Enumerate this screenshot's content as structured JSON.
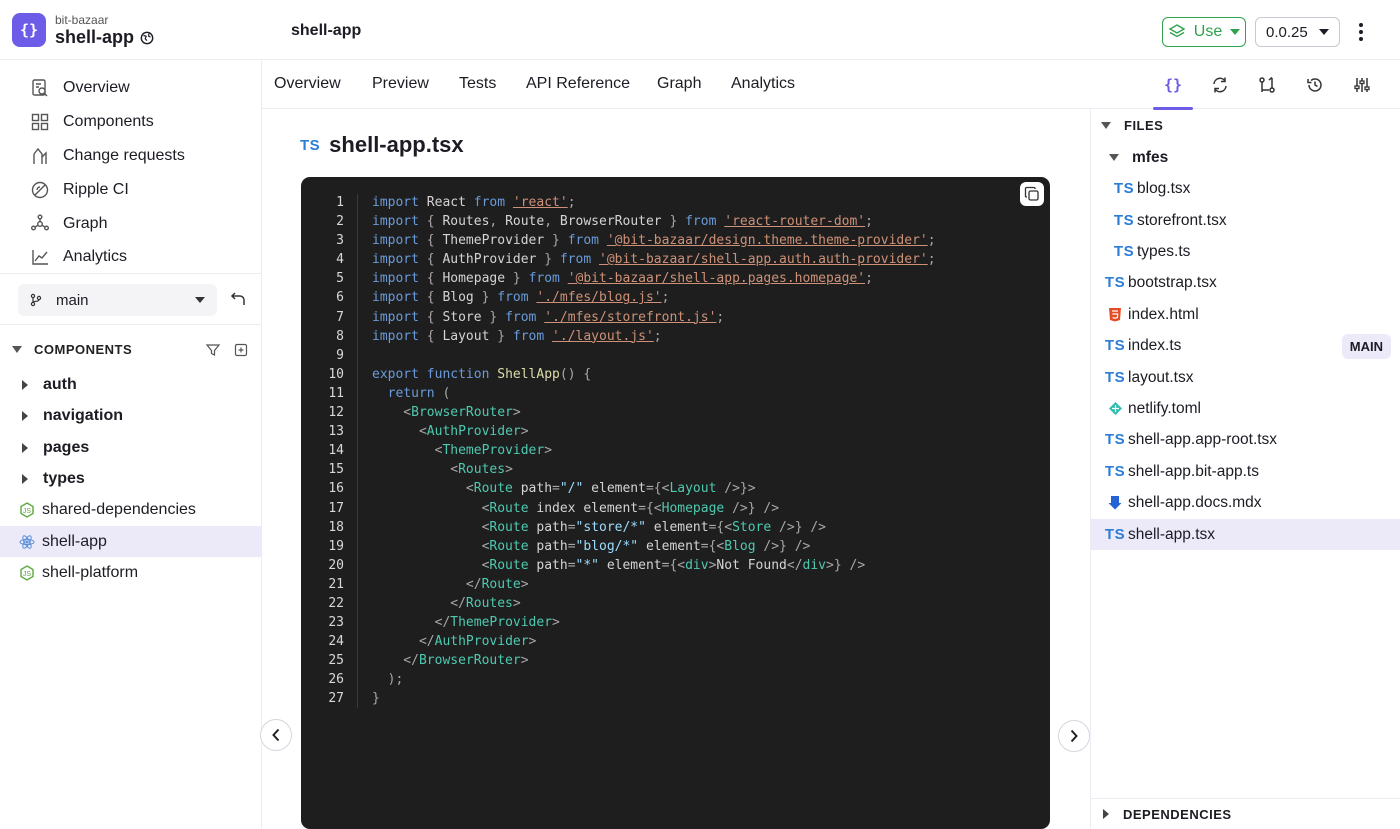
{
  "header": {
    "org": "bit-bazaar",
    "app": "shell-app",
    "breadcrumb": "shell-app",
    "use_label": "Use",
    "version": "0.0.25",
    "accent_color": "#6c5ce7",
    "use_color": "#2fa24c"
  },
  "sidebar": {
    "nav": [
      {
        "label": "Overview",
        "icon": "overview-icon"
      },
      {
        "label": "Components",
        "icon": "components-grid-icon"
      },
      {
        "label": "Change requests",
        "icon": "change-requests-icon"
      },
      {
        "label": "Ripple CI",
        "icon": "ripple-ci-icon"
      },
      {
        "label": "Graph",
        "icon": "graph-icon"
      },
      {
        "label": "Analytics",
        "icon": "analytics-icon"
      }
    ],
    "branch": "main",
    "components_heading": "COMPONENTS",
    "tree": [
      {
        "label": "auth",
        "kind": "folder"
      },
      {
        "label": "navigation",
        "kind": "folder"
      },
      {
        "label": "pages",
        "kind": "folder"
      },
      {
        "label": "types",
        "kind": "folder"
      },
      {
        "label": "shared-dependencies",
        "kind": "component"
      },
      {
        "label": "shell-app",
        "kind": "component",
        "selected": true
      },
      {
        "label": "shell-platform",
        "kind": "component"
      }
    ]
  },
  "tabs": [
    "Overview",
    "Preview",
    "Tests",
    "API Reference",
    "Graph",
    "Analytics"
  ],
  "toolbar_icons": [
    "code-icon",
    "refresh-icon",
    "compare-icon",
    "history-icon",
    "settings-sliders-icon"
  ],
  "editor": {
    "file_badge": "TS",
    "file_name": "shell-app.tsx",
    "lines": [
      "import React from 'react';",
      "import { Routes, Route, BrowserRouter } from 'react-router-dom';",
      "import { ThemeProvider } from '@bit-bazaar/design.theme.theme-provider';",
      "import { AuthProvider } from '@bit-bazaar/shell-app.auth.auth-provider';",
      "import { Homepage } from '@bit-bazaar/shell-app.pages.homepage';",
      "import { Blog } from './mfes/blog.js';",
      "import { Store } from './mfes/storefront.js';",
      "import { Layout } from './layout.js';",
      "",
      "export function ShellApp() {",
      "  return (",
      "    <BrowserRouter>",
      "      <AuthProvider>",
      "        <ThemeProvider>",
      "          <Routes>",
      "            <Route path=\"/\" element={<Layout />}>",
      "              <Route index element={<Homepage />} />",
      "              <Route path=\"store/*\" element={<Store />} />",
      "              <Route path=\"blog/*\" element={<Blog />} />",
      "              <Route path=\"*\" element={<div>Not Found</div>} />",
      "            </Route>",
      "          </Routes>",
      "        </ThemeProvider>",
      "      </AuthProvider>",
      "    </BrowserRouter>",
      "  );",
      "}"
    ]
  },
  "files_panel": {
    "heading": "FILES",
    "folder": "mfes",
    "folder_files": [
      {
        "name": "blog.tsx",
        "type": "TS"
      },
      {
        "name": "storefront.tsx",
        "type": "TS"
      },
      {
        "name": "types.ts",
        "type": "TS"
      }
    ],
    "files": [
      {
        "name": "bootstrap.tsx",
        "type": "TS"
      },
      {
        "name": "index.html",
        "type": "html5-icon"
      },
      {
        "name": "index.ts",
        "type": "TS",
        "badge": "MAIN"
      },
      {
        "name": "layout.tsx",
        "type": "TS"
      },
      {
        "name": "netlify.toml",
        "type": "netlify-icon"
      },
      {
        "name": "shell-app.app-root.tsx",
        "type": "TS"
      },
      {
        "name": "shell-app.bit-app.ts",
        "type": "TS"
      },
      {
        "name": "shell-app.docs.mdx",
        "type": "mdx-icon"
      },
      {
        "name": "shell-app.tsx",
        "type": "TS",
        "selected": true
      }
    ],
    "dependencies_heading": "DEPENDENCIES"
  }
}
